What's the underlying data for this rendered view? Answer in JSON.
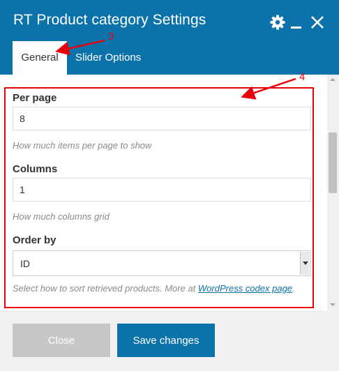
{
  "dialog": {
    "title": "RT Product category Settings",
    "header_icons": [
      "gear-icon",
      "minimize-icon",
      "close-icon"
    ]
  },
  "tabs": [
    {
      "label": "General",
      "active": true
    },
    {
      "label": "Slider Options",
      "active": false
    }
  ],
  "fields": {
    "per_page": {
      "label": "Per page",
      "value": "8",
      "help": "How much items per page to show"
    },
    "columns": {
      "label": "Columns",
      "value": "1",
      "help": "How much columns grid"
    },
    "order_by": {
      "label": "Order by",
      "selected": "ID",
      "help_prefix": "Select how to sort retrieved products. More at ",
      "help_link": "WordPress codex page",
      "help_suffix": "."
    }
  },
  "annotations": {
    "tabs_marker": "3",
    "content_marker": "4"
  },
  "footer": {
    "close_label": "Close",
    "save_label": "Save changes"
  },
  "colors": {
    "header": "#0b73aa",
    "annotation": "#e8000b",
    "primary_button": "#0b73aa",
    "disabled_button": "#c7c7c7"
  }
}
